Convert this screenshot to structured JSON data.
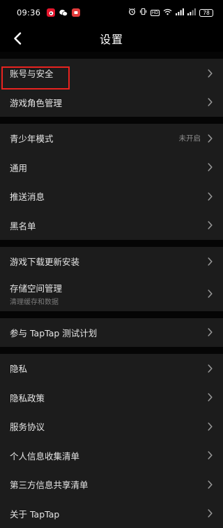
{
  "status_bar": {
    "time": "09:36",
    "hd_label": "HD",
    "battery": "78"
  },
  "header": {
    "title": "设置"
  },
  "groups": [
    {
      "items": [
        {
          "label": "账号与安全"
        },
        {
          "label": "游戏角色管理"
        }
      ]
    },
    {
      "items": [
        {
          "label": "青少年模式",
          "value": "未开启"
        },
        {
          "label": "通用"
        },
        {
          "label": "推送消息"
        },
        {
          "label": "黑名单"
        }
      ]
    },
    {
      "items": [
        {
          "label": "游戏下载更新安装"
        },
        {
          "label": "存储空间管理",
          "sub": "清理缓存和数据"
        }
      ]
    },
    {
      "items": [
        {
          "label": "参与 TapTap 测试计划"
        }
      ]
    },
    {
      "items": [
        {
          "label": "隐私"
        },
        {
          "label": "隐私政策"
        },
        {
          "label": "服务协议"
        },
        {
          "label": "个人信息收集清单"
        },
        {
          "label": "第三方信息共享清单"
        },
        {
          "label": "关于 TapTap"
        }
      ]
    }
  ],
  "colors": {
    "highlight": "#e8231f",
    "row_background": "#1c1c1c"
  }
}
